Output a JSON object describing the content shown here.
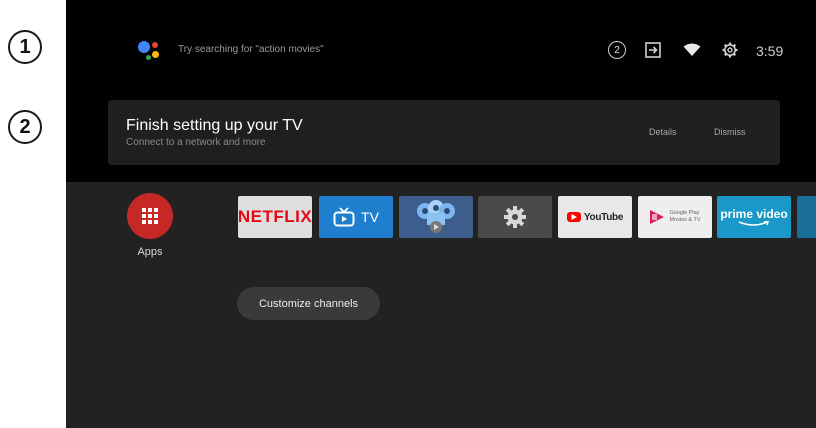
{
  "callouts": [
    "1",
    "2"
  ],
  "search": {
    "hint": "Try searching for \"action movies\""
  },
  "status": {
    "notification_count": "2",
    "clock": "3:59"
  },
  "setup_card": {
    "title": "Finish setting up your TV",
    "subtitle": "Connect to a network and more",
    "details_label": "Details",
    "dismiss_label": "Dismiss"
  },
  "apps": {
    "label": "Apps"
  },
  "tiles": {
    "netflix": "NETFLIX",
    "tv": "TV",
    "youtube": "YouTube",
    "google_play_line1": "Google Play",
    "google_play_line2": "Movies & TV",
    "prime": "prime video"
  },
  "customize": {
    "label": "Customize channels"
  },
  "colors": {
    "apps_red": "#c62828",
    "netflix_red": "#e50914",
    "tv_blue": "#1f7fce",
    "prime_blue": "#1a98c8",
    "youtube_red": "#ff0000"
  }
}
